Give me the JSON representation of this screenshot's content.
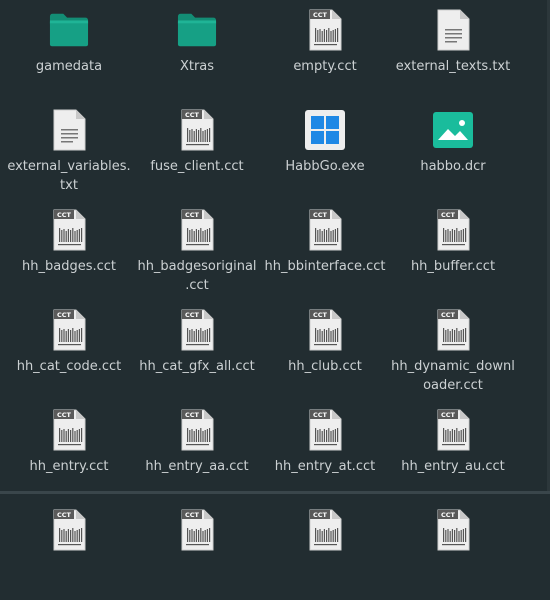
{
  "files": [
    {
      "name": "gamedata",
      "icon": "folder-icon"
    },
    {
      "name": "Xtras",
      "icon": "folder-icon"
    },
    {
      "name": "empty.cct",
      "icon": "cct-file-icon"
    },
    {
      "name": "external_texts.txt",
      "icon": "text-file-icon"
    },
    {
      "name": "external_variables.\ntxt",
      "icon": "text-file-icon"
    },
    {
      "name": "fuse_client.cct",
      "icon": "cct-file-icon"
    },
    {
      "name": "HabbGo.exe",
      "icon": "windows-exe-icon"
    },
    {
      "name": "habbo.dcr",
      "icon": "image-file-icon"
    },
    {
      "name": "hh_badges.cct",
      "icon": "cct-file-icon"
    },
    {
      "name": "hh_badgesoriginal\n.cct",
      "icon": "cct-file-icon"
    },
    {
      "name": "hh_bbinterface.cct",
      "icon": "cct-file-icon"
    },
    {
      "name": "hh_buffer.cct",
      "icon": "cct-file-icon"
    },
    {
      "name": "hh_cat_code.cct",
      "icon": "cct-file-icon"
    },
    {
      "name": "hh_cat_gfx_all.cct",
      "icon": "cct-file-icon"
    },
    {
      "name": "hh_club.cct",
      "icon": "cct-file-icon"
    },
    {
      "name": "hh_dynamic_downl\noader.cct",
      "icon": "cct-file-icon"
    },
    {
      "name": "hh_entry.cct",
      "icon": "cct-file-icon"
    },
    {
      "name": "hh_entry_aa.cct",
      "icon": "cct-file-icon"
    },
    {
      "name": "hh_entry_at.cct",
      "icon": "cct-file-icon"
    },
    {
      "name": "hh_entry_au.cct",
      "icon": "cct-file-icon"
    },
    {
      "name": "",
      "icon": "cct-file-icon"
    },
    {
      "name": "",
      "icon": "cct-file-icon"
    },
    {
      "name": "",
      "icon": "cct-file-icon"
    },
    {
      "name": "",
      "icon": "cct-file-icon"
    }
  ],
  "icon_badge_text": "CCT",
  "colors": {
    "background": "#222d31",
    "folder": "#16a085",
    "folder_tab": "#138d75",
    "windows": "#1e88e5",
    "image_file": "#1abc9c",
    "text": "#ccd1d3"
  }
}
